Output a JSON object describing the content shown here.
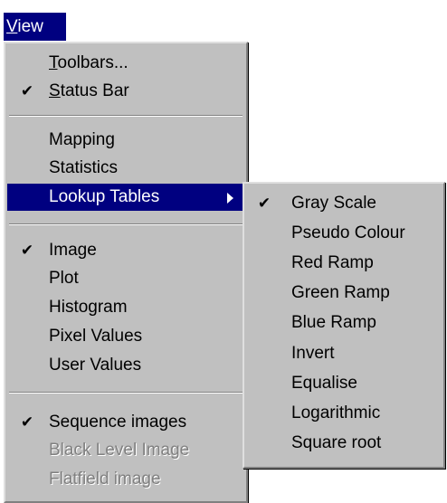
{
  "menubar": {
    "view_label": "View",
    "view_mnemonic": "V",
    "view_rest": "iew"
  },
  "view_menu": {
    "toolbars": {
      "mnemonic": "T",
      "rest": "oolbars...",
      "checked": false
    },
    "status_bar": {
      "mnemonic": "S",
      "rest": "tatus Bar",
      "checked": true
    },
    "mapping": {
      "label": "Mapping",
      "checked": false
    },
    "statistics": {
      "label": "Statistics",
      "checked": false
    },
    "lookup_tables": {
      "label": "Lookup Tables",
      "highlighted": true,
      "has_submenu": true
    },
    "image": {
      "label": "Image",
      "checked": true
    },
    "plot": {
      "label": "Plot",
      "checked": false
    },
    "histogram": {
      "label": "Histogram",
      "checked": false
    },
    "pixel_values": {
      "label": "Pixel Values",
      "checked": false
    },
    "user_values": {
      "label": "User Values",
      "checked": false
    },
    "sequence_images": {
      "label": "Sequence images",
      "checked": true
    },
    "black_level_image": {
      "label": "Black Level Image",
      "disabled": true
    },
    "flatfield_image": {
      "label": "Flatfield image",
      "disabled": true
    }
  },
  "lookup_submenu": {
    "items": [
      {
        "label": "Gray Scale",
        "checked": true
      },
      {
        "label": "Pseudo Colour",
        "checked": false
      },
      {
        "label": "Red Ramp",
        "checked": false
      },
      {
        "label": "Green Ramp",
        "checked": false
      },
      {
        "label": "Blue Ramp",
        "checked": false
      },
      {
        "label": "Invert",
        "checked": false
      },
      {
        "label": "Equalise",
        "checked": false
      },
      {
        "label": "Logarithmic",
        "checked": false
      },
      {
        "label": "Square root",
        "checked": false
      }
    ]
  },
  "glyphs": {
    "check": "✔"
  },
  "colors": {
    "menu_face": "#c0c0c0",
    "highlight": "#000080",
    "highlight_text": "#ffffff",
    "disabled_text": "#808080"
  }
}
